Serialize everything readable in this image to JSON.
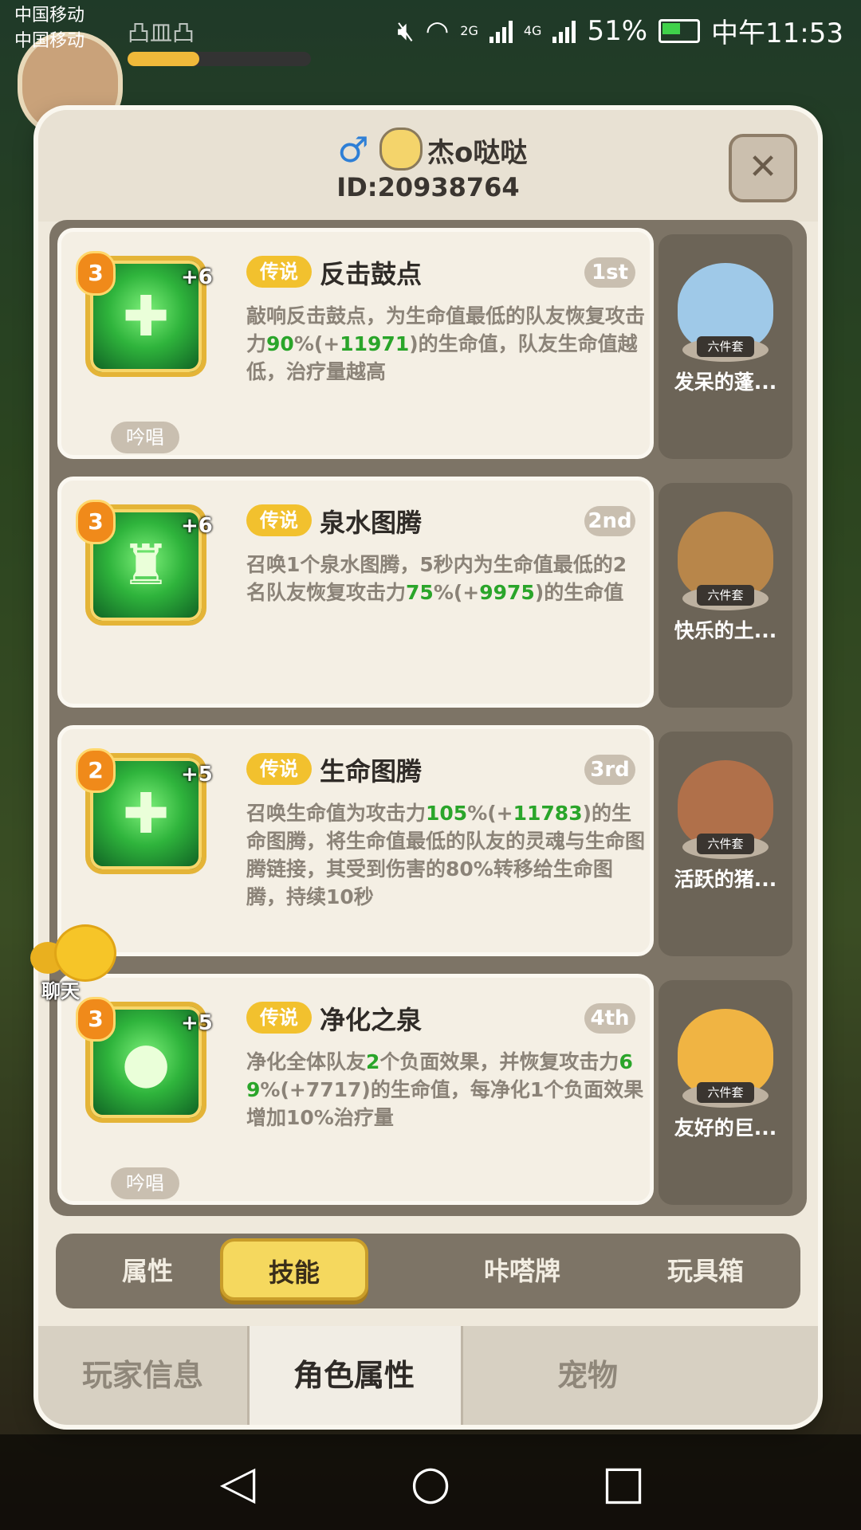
{
  "status_bar": {
    "carrier1": "中国移动",
    "carrier2": "中国移动",
    "battery_percent": "51%",
    "time": "中午11:53",
    "net1": "2G",
    "net2": "4G"
  },
  "hud": {
    "player_name": "凸皿凸"
  },
  "modal": {
    "player_name": "杰o哒哒",
    "player_id": "ID:20938764",
    "close_icon": "close-icon"
  },
  "skills": [
    {
      "level": "3",
      "plus": "+6",
      "rarity": "传说",
      "name": "反击鼓点",
      "rank": "1st",
      "desc_parts": [
        "敲响反击鼓点，为生命值最低的队友恢复攻击力",
        "90",
        "%(+",
        "11971",
        ")的生命值，队友生命值越低，治疗量越高"
      ],
      "chant": "吟唱",
      "pet_set": "六件套",
      "pet_name": "发呆的蓬..."
    },
    {
      "level": "3",
      "plus": "+6",
      "rarity": "传说",
      "name": "泉水图腾",
      "rank": "2nd",
      "desc_parts": [
        "召唤1个泉水图腾，5秒内为生命值最低的2名队友恢复攻击力",
        "75",
        "%(+",
        "9975",
        ")的生命值"
      ],
      "chant": "",
      "pet_set": "六件套",
      "pet_name": "快乐的土..."
    },
    {
      "level": "2",
      "plus": "+5",
      "rarity": "传说",
      "name": "生命图腾",
      "rank": "3rd",
      "desc_parts": [
        "召唤生命值为攻击力",
        "105",
        "%(+",
        "11783",
        ")的生命图腾，将生命值最低的队友的灵魂与生命图腾链接，其受到伤害的80%转移给生命图腾，持续10秒"
      ],
      "chant": "",
      "pet_set": "六件套",
      "pet_name": "活跃的猪..."
    },
    {
      "level": "3",
      "plus": "+5",
      "rarity": "传说",
      "name": "净化之泉",
      "rank": "4th",
      "desc_parts": [
        "净化全体队友",
        "2",
        "个负面效果，并恢复攻击力",
        "69",
        "%(+7717)的生命值，每净化1个负面效果增加10%治疗量"
      ],
      "chant": "吟唱",
      "pet_set": "六件套",
      "pet_name": "友好的巨..."
    }
  ],
  "chat": {
    "label": "聊天"
  },
  "inner_tabs": [
    "属性",
    "技能",
    "咔嗒牌",
    "玩具箱"
  ],
  "inner_tab_active": 1,
  "bottom_tabs": [
    "玩家信息",
    "角色属性",
    "宠物"
  ],
  "bottom_tab_active": 1,
  "nav": {
    "back": "◁",
    "home": "○",
    "recent": "□"
  },
  "colors": {
    "accent": "#f5d85e",
    "highlight": "#2aa52a",
    "rarity": "#f2c12e"
  }
}
